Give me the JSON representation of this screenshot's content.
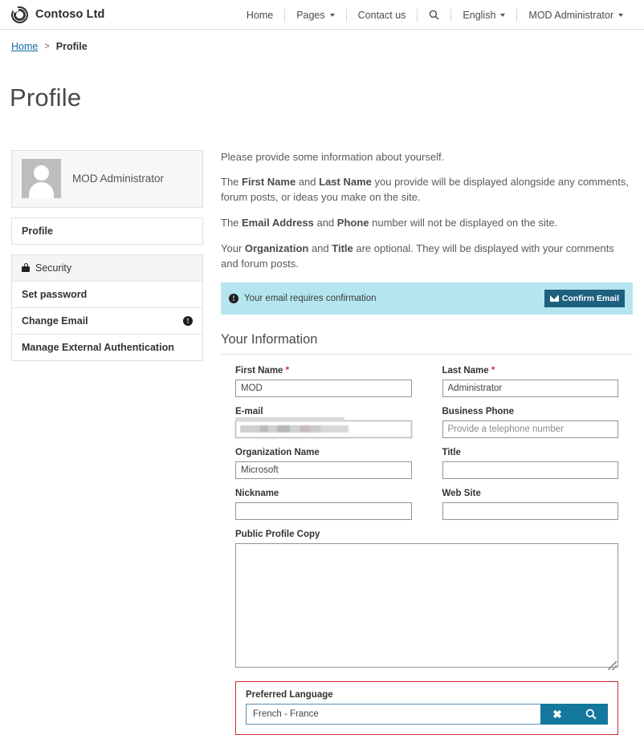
{
  "header": {
    "brand": "Contoso Ltd",
    "logo_icon": "contoso-swirl-logo-icon",
    "nav": [
      {
        "label": "Home",
        "caret": false
      },
      {
        "label": "Pages",
        "caret": true
      },
      {
        "label": "Contact us",
        "caret": false
      },
      {
        "label": "",
        "caret": false,
        "icon": "search-icon"
      },
      {
        "label": "English",
        "caret": true
      },
      {
        "label": "MOD Administrator",
        "caret": true
      }
    ]
  },
  "breadcrumb": {
    "home": "Home",
    "separator": ">",
    "current": "Profile"
  },
  "page": {
    "title": "Profile"
  },
  "sidebar": {
    "profile": {
      "name": "MOD Administrator",
      "avatar_icon": "user-avatar-placeholder-icon"
    },
    "profile_link": "Profile",
    "security": {
      "heading": "Security",
      "lock_icon": "lock-icon",
      "items": [
        {
          "label": "Set password",
          "badge": false
        },
        {
          "label": "Change Email",
          "badge": true,
          "badge_icon": "info-circle-icon"
        },
        {
          "label": "Manage External Authentication",
          "badge": false
        }
      ]
    }
  },
  "intro": {
    "p1": "Please provide some information about yourself.",
    "p2_a": "The ",
    "p2_b1": "First Name",
    "p2_c": " and ",
    "p2_b2": "Last Name",
    "p2_d": " you provide will be displayed alongside any comments, forum posts, or ideas you make on the site.",
    "p3_a": "The ",
    "p3_b1": "Email Address",
    "p3_c": " and ",
    "p3_b2": "Phone",
    "p3_d": " number will not be displayed on the site.",
    "p4_a": "Your ",
    "p4_b1": "Organization",
    "p4_c": " and ",
    "p4_b2": "Title",
    "p4_d": " are optional. They will be displayed with your comments and forum posts."
  },
  "alert": {
    "icon": "info-circle-icon",
    "message": "Your email requires confirmation",
    "button_label": "Confirm Email",
    "button_icon": "envelope-icon",
    "bg_color": "#b5e6ef",
    "button_color": "#1f5f80"
  },
  "form": {
    "section_title": "Your Information",
    "fields": {
      "first_name": {
        "label": "First Name",
        "required": true,
        "value": "MOD",
        "placeholder": ""
      },
      "last_name": {
        "label": "Last Name",
        "required": true,
        "value": "Administrator",
        "placeholder": ""
      },
      "email": {
        "label": "E-mail",
        "required": false,
        "value": "",
        "placeholder": "",
        "redacted": true
      },
      "business_phone": {
        "label": "Business Phone",
        "required": false,
        "value": "",
        "placeholder": "Provide a telephone number"
      },
      "organization_name": {
        "label": "Organization Name",
        "required": false,
        "value": "Microsoft",
        "placeholder": ""
      },
      "title": {
        "label": "Title",
        "required": false,
        "value": "",
        "placeholder": ""
      },
      "nickname": {
        "label": "Nickname",
        "required": false,
        "value": "",
        "placeholder": ""
      },
      "web_site": {
        "label": "Web Site",
        "required": false,
        "value": "",
        "placeholder": ""
      },
      "public_profile_copy": {
        "label": "Public Profile Copy",
        "required": false,
        "value": "",
        "placeholder": ""
      },
      "preferred_language": {
        "label": "Preferred Language",
        "required": false,
        "value": "French - France",
        "placeholder": "",
        "clear_icon": "close-x-icon",
        "search_icon": "search-icon",
        "accent_color": "#13789b",
        "highlight_color": "#cf2b2b"
      }
    },
    "required_marker": "*"
  }
}
